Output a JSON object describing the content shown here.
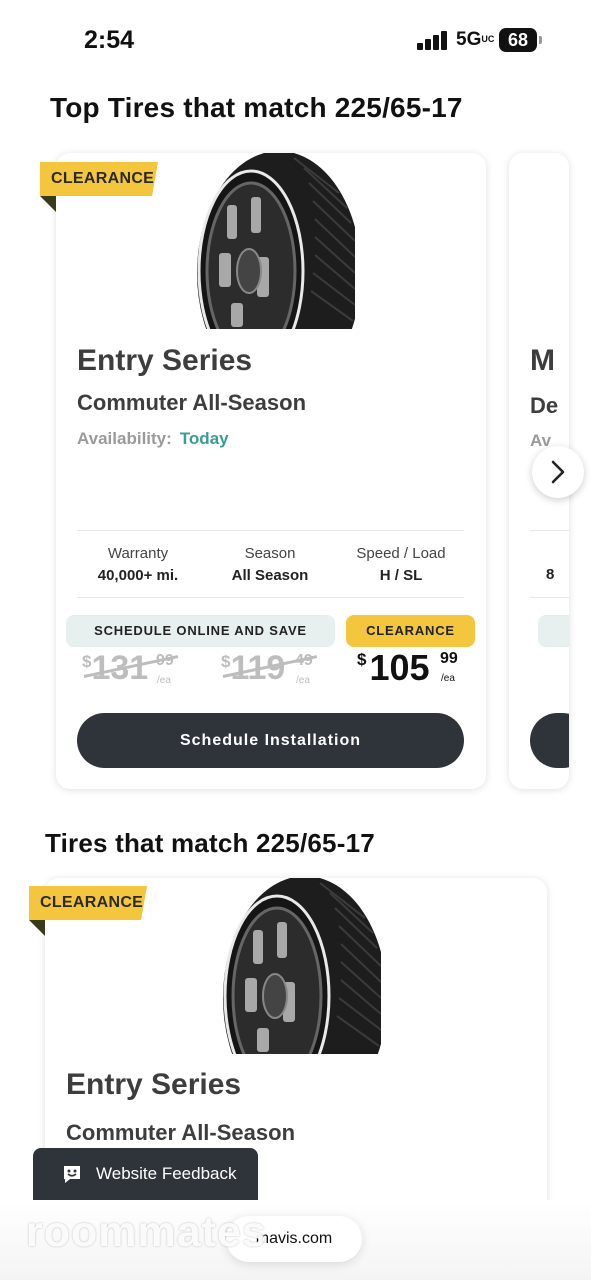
{
  "status_bar": {
    "time": "2:54",
    "network": "5G",
    "network_sub": "UC",
    "battery": "68"
  },
  "top_section": {
    "title": "Top Tires that match 225/65-17"
  },
  "card1": {
    "ribbon": "CLEARANCE",
    "series": "Entry Series",
    "subtitle": "Commuter All-Season",
    "availability_label": "Availability:",
    "availability_value": "Today",
    "specs": [
      {
        "label": "Warranty",
        "value": "40,000+ mi."
      },
      {
        "label": "Season",
        "value": "All Season"
      },
      {
        "label": "Speed / Load",
        "value": "H / SL"
      }
    ],
    "promo_label": "SCHEDULE ONLINE AND SAVE",
    "clearance_label": "CLEARANCE",
    "price_old1": {
      "currency": "$",
      "whole": "131",
      "cents": "99",
      "unit": "/ea"
    },
    "price_old2": {
      "currency": "$",
      "whole": "119",
      "cents": "49",
      "unit": "/ea"
    },
    "price_now": {
      "currency": "$",
      "whole": "105",
      "cents": "99",
      "unit": "/ea"
    },
    "cta": "Schedule Installation"
  },
  "card2_peek": {
    "series": "M",
    "subtitle": "De",
    "availability": "Av",
    "spec": "8"
  },
  "list_section": {
    "title": "Tires that match 225/65-17"
  },
  "list_card": {
    "ribbon": "CLEARANCE",
    "series": "Entry Series",
    "subtitle": "Commuter All-Season"
  },
  "feedback": {
    "label": "Website Feedback"
  },
  "browser": {
    "url": "mavis.com"
  },
  "watermark": "roommates",
  "colors": {
    "accent_yellow": "#f3c63d",
    "dark_button": "#2f343b",
    "availability_teal": "#3a9d94"
  }
}
